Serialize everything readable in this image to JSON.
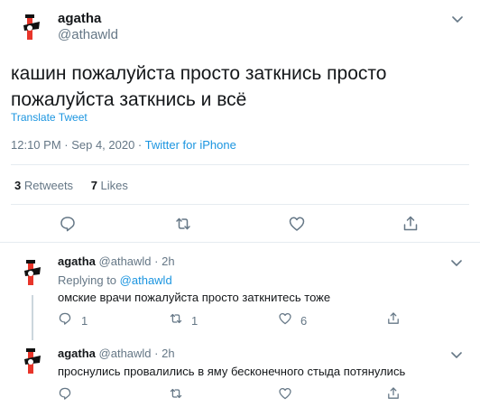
{
  "main_tweet": {
    "display_name": "agatha",
    "handle": "@athawld",
    "text_line1": "кашин пожалуйста просто заткнись просто",
    "text_line2": "пожалуйста заткнись и всё",
    "translate_label": "Translate Tweet",
    "timestamp": "12:10 PM · Sep 4, 2020 · ",
    "source": "Twitter for iPhone",
    "retweets_count": "3",
    "retweets_label": "Retweets",
    "likes_count": "7",
    "likes_label": "Likes"
  },
  "replies": [
    {
      "display_name": "agatha",
      "handle": "@athawld",
      "time": "· 2h",
      "replying_prefix": "Replying to",
      "replying_to": "@athawld",
      "text": "омские врачи пожалуйста просто заткнитесь тоже",
      "reply_count": "1",
      "retweet_count": "1",
      "like_count": "6"
    },
    {
      "display_name": "agatha",
      "handle": "@athawld",
      "time": "· 2h",
      "text": "проснулись провалились в яму бесконечного стыда потянулись"
    }
  ],
  "icons": [
    "chevron-down-icon",
    "reply-icon",
    "retweet-icon",
    "like-icon",
    "share-icon"
  ],
  "colors": {
    "link": "#1b95e0",
    "muted": "#657786",
    "text": "#14171a",
    "divider": "#e6ecf0"
  }
}
